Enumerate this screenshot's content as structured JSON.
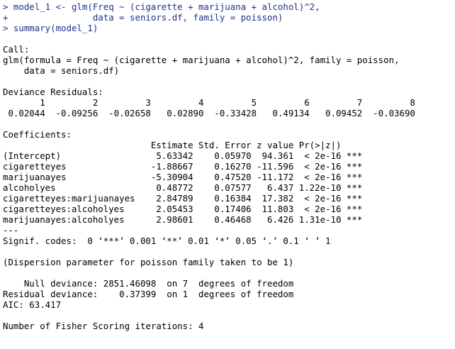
{
  "console": {
    "input": [
      "> model_1 <- glm(Freq ~ (cigarette + marijuana + alcohol)^2,",
      "+                data = seniors.df, family = poisson)",
      "> summary(model_1)"
    ],
    "call": [
      "Call:",
      "glm(formula = Freq ~ (cigarette + marijuana + alcohol)^2, family = poisson,",
      "    data = seniors.df)"
    ],
    "deviance": [
      "Deviance Residuals:",
      "       1         2         3         4         5         6         7         8",
      " 0.02044  -0.09256  -0.02658   0.02890  -0.33428   0.49134   0.09452  -0.03690"
    ],
    "coef_title": "Coefficients:",
    "coef_header": "                            Estimate Std. Error z value Pr(>|z|)    ",
    "coef_rows": [
      "(Intercept)                  5.63342    0.05970  94.361  < 2e-16 ***",
      "cigaretteyes                -1.88667    0.16270 -11.596  < 2e-16 ***",
      "marijuanayes                -5.30904    0.47520 -11.172  < 2e-16 ***",
      "alcoholyes                   0.48772    0.07577   6.437 1.22e-10 ***",
      "cigaretteyes:marijuanayes    2.84789    0.16384  17.382  < 2e-16 ***",
      "cigaretteyes:alcoholyes      2.05453    0.17406  11.803  < 2e-16 ***",
      "marijuanayes:alcoholyes      2.98601    0.46468   6.426 1.31e-10 ***"
    ],
    "signif": [
      "---",
      "Signif. codes:  0 ‘***’ 0.001 ‘**’ 0.01 ‘*’ 0.05 ‘.’ 0.1 ‘ ’ 1"
    ],
    "dispersion": "(Dispersion parameter for poisson family taken to be 1)",
    "deviance_summary": [
      "    Null deviance: 2851.46098  on 7  degrees of freedom",
      "Residual deviance:    0.37399  on 1  degrees of freedom",
      "AIC: 63.417"
    ],
    "fisher": "Number of Fisher Scoring iterations: 4",
    "colors": {
      "input_text": "#1d2f8c",
      "output_text": "#000000",
      "background": "#ffffff"
    }
  }
}
